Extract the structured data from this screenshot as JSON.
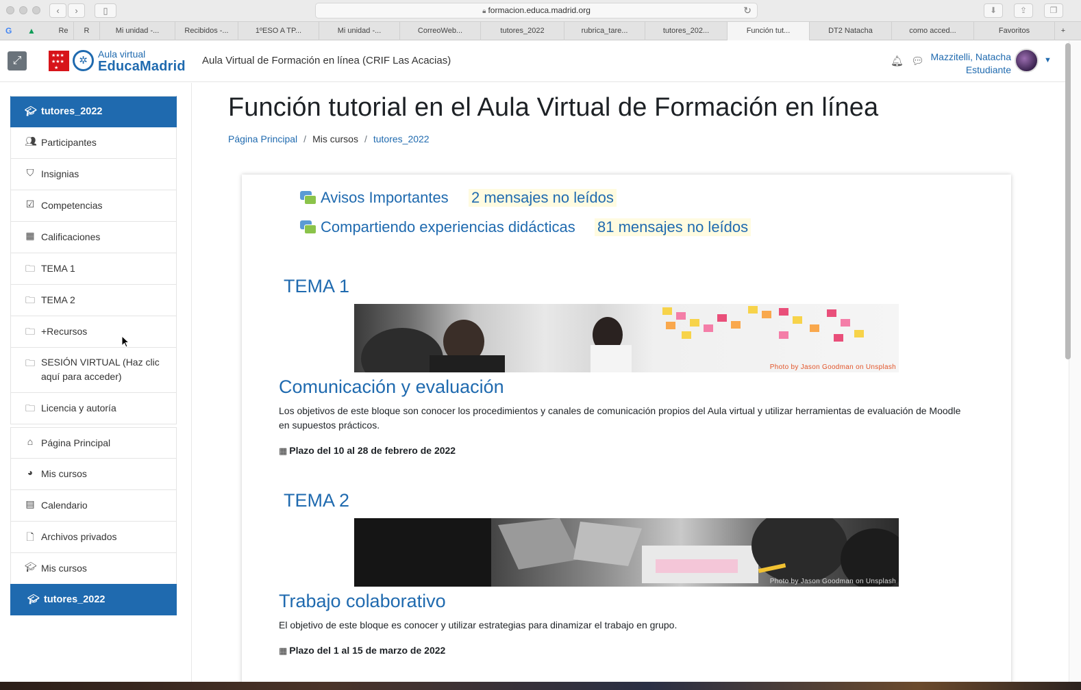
{
  "browser": {
    "url": "formacion.educa.madrid.org",
    "tabs": [
      "Re",
      "R",
      "Mi unidad -...",
      "Recibidos -...",
      "1ºESO A TP...",
      "Mi unidad -...",
      "CorreoWeb...",
      "tutores_2022",
      "rubrica_tare...",
      "tutores_202...",
      "Función tut...",
      "DT2 Natacha",
      "como acced...",
      "Favoritos"
    ],
    "active_tab": "Función tut..."
  },
  "header": {
    "logo_small": "Aula virtual",
    "logo_big": "EducaMadrid",
    "site_name": "Aula Virtual de Formación en línea (CRIF Las Acacias)",
    "user_name": "Mazzitelli, Natacha",
    "user_role": "Estudiante"
  },
  "sidebar": {
    "course": "tutores_2022",
    "items": [
      {
        "label": "Participantes",
        "icon": "users-icon"
      },
      {
        "label": "Insignias",
        "icon": "shield-icon"
      },
      {
        "label": "Competencias",
        "icon": "checkbox-icon"
      },
      {
        "label": "Calificaciones",
        "icon": "table-icon"
      },
      {
        "label": "TEMA 1",
        "icon": "folder-icon"
      },
      {
        "label": "TEMA 2",
        "icon": "folder-icon"
      },
      {
        "label": "+Recursos",
        "icon": "folder-icon"
      },
      {
        "label": "SESIÓN VIRTUAL (Haz clic aquí para acceder)",
        "icon": "folder-icon"
      },
      {
        "label": "Licencia y autoría",
        "icon": "folder-icon"
      }
    ],
    "items2": [
      {
        "label": "Página Principal",
        "icon": "home-icon"
      },
      {
        "label": "Mis cursos",
        "icon": "dashboard-icon"
      },
      {
        "label": "Calendario",
        "icon": "calendar-icon"
      },
      {
        "label": "Archivos privados",
        "icon": "file-icon"
      },
      {
        "label": "Mis cursos",
        "icon": "graduation-cap-icon"
      }
    ],
    "bottom_course": "tutores_2022"
  },
  "main": {
    "title": "Función tutorial en el Aula Virtual de Formación en línea",
    "breadcrumb": [
      "Página Principal",
      "Mis cursos",
      "tutores_2022"
    ],
    "forums": [
      {
        "name": "Avisos Importantes",
        "unread": "2 mensajes no leídos"
      },
      {
        "name": "Compartiendo experiencias didácticas",
        "unread": "81 mensajes no leídos"
      }
    ],
    "sections": [
      {
        "heading": "TEMA 1",
        "image_credit": "Photo by Jason Goodman on Unsplash",
        "title": "Comunicación y evaluación",
        "description": "Los objetivos de este bloque son conocer los procedimientos y canales de comunicación propios del Aula virtual y utilizar herramientas de evaluación de Moodle en supuestos prácticos.",
        "deadline": "Plazo del 10 al 28 de febrero de 2022"
      },
      {
        "heading": "TEMA 2",
        "image_credit": "Photo by Jason Goodman on Unsplash",
        "title": "Trabajo colaborativo",
        "description": "El objetivo de este bloque es conocer y utilizar estrategias para dinamizar el trabajo en grupo.",
        "deadline": "Plazo del 1 al 15 de marzo de 2022"
      }
    ]
  },
  "colors": {
    "brand_blue": "#1f6aaf",
    "unread_bg": "#fffbe0",
    "flag_red": "#d7141a"
  }
}
